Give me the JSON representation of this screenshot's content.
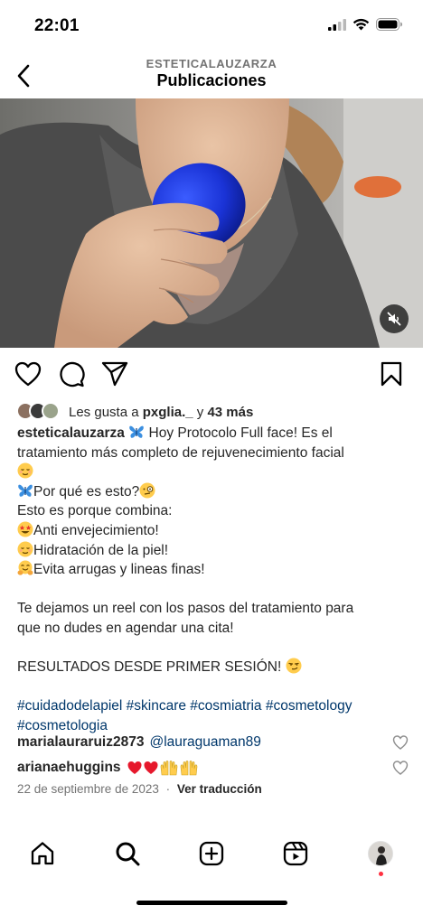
{
  "status_bar": {
    "time": "22:01"
  },
  "header": {
    "account": "ESTETICALAUZARZA",
    "title": "Publicaciones"
  },
  "likes": {
    "prefix": "Les gusta a ",
    "user": "pxglia._",
    "joiner": " y ",
    "count": "43 más"
  },
  "caption": {
    "username": "esteticalauzarza",
    "line1": " Hoy Protocolo Full face! Es el",
    "line2": "tratamiento más completo de rejuvenecimiento facial",
    "line4": "Por qué es esto?",
    "line5": "Esto es porque combina:",
    "line6": "Anti envejecimiento!",
    "line7": "Hidratación de la piel!",
    "line8": "Evita arrugas y lineas finas!",
    "line10": "Te dejamos un reel con los pasos del tratamiento para",
    "line11": "que no dudes en agendar una cita!",
    "line13": "RESULTADOS DESDE PRIMER SESIÓN! ",
    "hashtags_line1": "#cuidadodelapiel #skincare #cosmiatria #cosmetology",
    "hashtags_line2": "#cosmetologia"
  },
  "comments": [
    {
      "user": "marialauraruiz2873",
      "text": "@lauraguaman89"
    },
    {
      "user": "arianaehuggins",
      "text": ""
    }
  ],
  "meta": {
    "date": "22 de septiembre de 2023",
    "separator": "·",
    "translate": "Ver traducción"
  },
  "icons": {
    "status": [
      "signal-icon",
      "wifi-icon",
      "battery-icon"
    ],
    "actions": [
      "heart-icon",
      "comment-icon",
      "share-icon",
      "bookmark-icon"
    ],
    "tabs": [
      "home-icon",
      "search-icon",
      "create-icon",
      "reels-icon",
      "profile-avatar"
    ]
  },
  "colors": {
    "link": "#00376b",
    "secondary_text": "#737373",
    "notification_dot": "#ff3040"
  }
}
